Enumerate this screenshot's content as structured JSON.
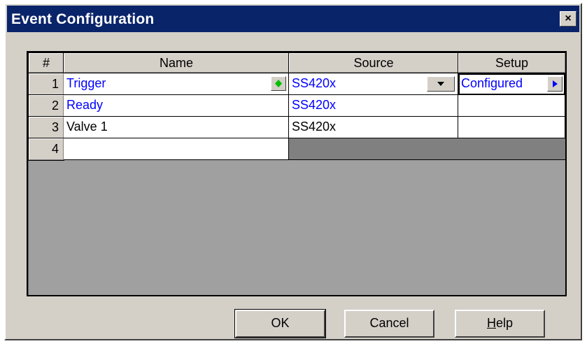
{
  "window": {
    "title": "Event Configuration",
    "close_glyph": "×"
  },
  "grid": {
    "headers": {
      "index": "#",
      "name": "Name",
      "source": "Source",
      "setup": "Setup"
    },
    "rows": [
      {
        "index": "1",
        "name": "Trigger",
        "source": "SS420x",
        "setup": "Configured"
      },
      {
        "index": "2",
        "name": "Ready",
        "source": "SS420x",
        "setup": ""
      },
      {
        "index": "3",
        "name": "Valve 1",
        "source": "SS420x",
        "setup": ""
      },
      {
        "index": "4",
        "name": "",
        "source": "",
        "setup": ""
      }
    ],
    "colors": {
      "highlight_text": "#0000ff",
      "diamond_icon": "#00c000",
      "disabled_cell": "#808080"
    }
  },
  "buttons": {
    "ok": "OK",
    "cancel": "Cancel",
    "help_mnemonic": "H",
    "help_rest": "elp"
  }
}
